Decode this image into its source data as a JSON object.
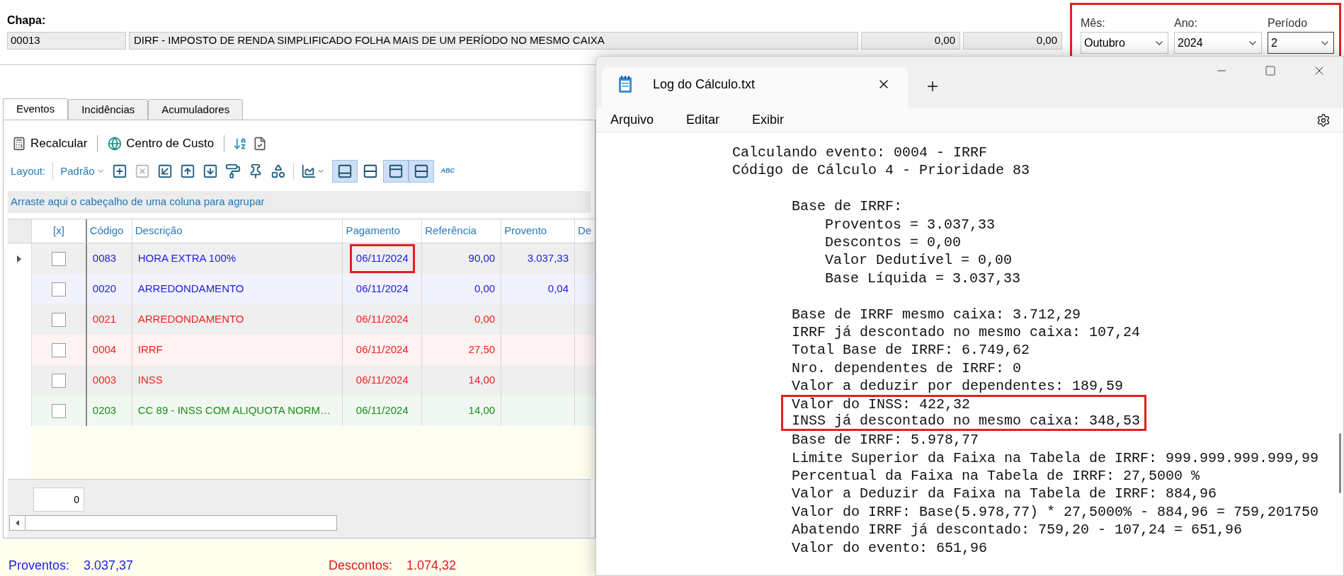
{
  "chapa": {
    "label": "Chapa:",
    "code": "00013",
    "description": "DIRF - IMPOSTO DE RENDA SIMPLIFICADO FOLHA MAIS DE UM PERÍODO NO MESMO CAIXA",
    "value_1": "0,00",
    "value_2": "0,00"
  },
  "period": {
    "highlighted": true,
    "fields": [
      {
        "label": "Mês:",
        "value": "Outubro",
        "focused": false
      },
      {
        "label": "Ano:",
        "value": "2024",
        "focused": false
      },
      {
        "label": "Período",
        "value": "2",
        "focused": true
      }
    ]
  },
  "tabs": [
    {
      "label": "Eventos",
      "selected": true
    },
    {
      "label": "Incidências",
      "selected": false
    },
    {
      "label": "Acumuladores",
      "selected": false
    }
  ],
  "toolbar": {
    "buttons": [
      {
        "kind": "calculator",
        "label": "Recalcular"
      },
      {
        "kind": "globe",
        "label": "Centro de Custo"
      }
    ],
    "icons": [
      {
        "kind": "sort"
      },
      {
        "kind": "document"
      }
    ]
  },
  "layout_bar": {
    "label": "Layout:",
    "preset": "Padrão",
    "tools": [
      {
        "kind": "add",
        "disabled": false
      },
      {
        "kind": "delete",
        "disabled": true
      },
      {
        "kind": "enter",
        "disabled": false
      },
      {
        "kind": "up",
        "disabled": false
      },
      {
        "kind": "down",
        "disabled": false
      },
      {
        "kind": "format",
        "disabled": false
      },
      {
        "kind": "pin",
        "disabled": false
      },
      {
        "kind": "shapes",
        "disabled": false
      }
    ],
    "toggles": [
      {
        "kind": "panel-bottom",
        "selected": true
      },
      {
        "kind": "rows",
        "selected": false
      },
      {
        "kind": "panel-top",
        "selected": true
      },
      {
        "kind": "rows",
        "selected": true
      }
    ],
    "spell_label": "ABC"
  },
  "group_hint": "Arraste aqui o cabeçalho de uma coluna para agrupar",
  "grid": {
    "check_header": "[x]",
    "columns": [
      "Código",
      "Descrição",
      "Pagamento",
      "Referência",
      "Provento",
      "De"
    ],
    "rows": [
      {
        "current": true,
        "checked": false,
        "highlighted": true,
        "color": "#2020e0",
        "cells": [
          "0083",
          "HORA EXTRA 100%",
          "06/11/2024",
          "90,00",
          "3.037,33"
        ]
      },
      {
        "current": false,
        "checked": false,
        "highlighted": false,
        "color": "#2020e0",
        "cells": [
          "0020",
          "ARREDONDAMENTO",
          "06/11/2024",
          "0,00",
          "0,04"
        ]
      },
      {
        "current": false,
        "checked": false,
        "highlighted": false,
        "color": "#f02020",
        "cells": [
          "0021",
          "ARREDONDAMENTO",
          "06/11/2024",
          "0,00"
        ]
      },
      {
        "current": false,
        "checked": false,
        "highlighted": false,
        "color": "#f02020",
        "cells": [
          "0004",
          "IRRF",
          "06/11/2024",
          "27,50"
        ]
      },
      {
        "current": false,
        "checked": false,
        "highlighted": false,
        "color": "#f02020",
        "cells": [
          "0003",
          "INSS",
          "06/11/2024",
          "14,00"
        ]
      },
      {
        "current": false,
        "checked": false,
        "highlighted": false,
        "color": "#1a8c1a",
        "cells": [
          "0203",
          "CC 89 - INSS COM ALIQUOTA NORM…",
          "06/11/2024",
          "14,00"
        ]
      }
    ]
  },
  "footer_count": "0",
  "totals": [
    {
      "label": "Proventos:",
      "value": "3.037,37",
      "color": "#2020e0"
    },
    {
      "label": "Descontos:",
      "value": "1.074,32",
      "color": "#e01818"
    }
  ],
  "notepad": {
    "tab_title": "Log do Cálculo.txt",
    "menu": [
      "Arquivo",
      "Editar",
      "Exibir"
    ],
    "log": {
      "lines": [
        {
          "text": "Calculando evento: 0004 - IRRF",
          "highlighted": false
        },
        {
          "text": "Código de Cálculo 4 - Prioridade 83",
          "highlighted": false
        }
      ],
      "children": [
        {
          "lines": [
            {
              "text": "Base de IRRF:",
              "highlighted": false
            }
          ],
          "children": [
            {
              "lines": [
                {
                  "text": "Proventos = 3.037,33",
                  "highlighted": false
                },
                {
                  "text": "Descontos = 0,00",
                  "highlighted": false
                },
                {
                  "text": "Valor Dedutível = 0,00",
                  "highlighted": false
                },
                {
                  "text": "Base Líquida = 3.037,33",
                  "highlighted": false
                }
              ]
            }
          ]
        },
        {
          "lines": [
            {
              "text": "Base de IRRF mesmo caixa: 3.712,29",
              "highlighted": false
            },
            {
              "text": "IRRF já descontado no mesmo caixa: 107,24",
              "highlighted": false
            },
            {
              "text": "Total Base de IRRF: 6.749,62",
              "highlighted": false
            },
            {
              "text": "Nro. dependentes de IRRF: 0",
              "highlighted": false
            },
            {
              "text": "Valor a deduzir por dependentes: 189,59",
              "highlighted": false
            },
            {
              "text": "Valor do INSS: 422,32",
              "highlighted": true
            },
            {
              "text": "INSS já descontado no mesmo caixa: 348,53",
              "highlighted": true
            },
            {
              "text": "Base de IRRF: 5.978,77",
              "highlighted": false
            },
            {
              "text": "Limite Superior da Faixa na Tabela de IRRF: 999.999.999.999,99",
              "highlighted": false
            },
            {
              "text": "Percentual da Faixa na Tabela de IRRF: 27,5000 %",
              "highlighted": false
            },
            {
              "text": "Valor a Deduzir da Faixa na Tabela de IRRF: 884,96",
              "highlighted": false
            },
            {
              "text": "Valor do IRRF: Base(5.978,77) * 27,5000% - 884,96 = 759,201750",
              "highlighted": false
            },
            {
              "text": "Abatendo IRRF já descontado: 759,20 - 107,24 = 651,96",
              "highlighted": false
            },
            {
              "text": "Valor do evento: 651,96",
              "highlighted": false
            }
          ]
        }
      ]
    }
  }
}
